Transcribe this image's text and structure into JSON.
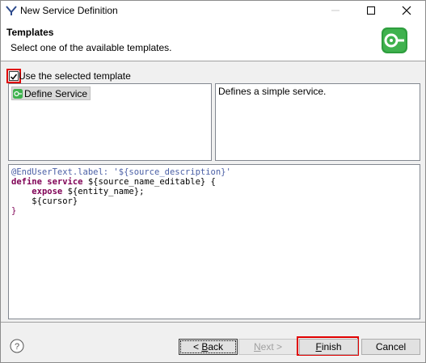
{
  "window": {
    "title": "New Service Definition"
  },
  "header": {
    "title": "Templates",
    "description": "Select one of the available templates."
  },
  "options": {
    "use_template_label": "Use the selected template",
    "use_template_checked": true
  },
  "templates": {
    "items": [
      {
        "label": "Define Service",
        "selected": true
      }
    ],
    "description": "Defines a simple service."
  },
  "code_preview": {
    "lines": [
      "@EndUserText.label: '${source_description}'",
      "define service ${source_name_editable} {",
      "    expose ${entity_name};",
      "    ${cursor}",
      "}"
    ]
  },
  "buttons": {
    "back_prefix": "< ",
    "back_mnemonic": "B",
    "back_rest": "ack",
    "next_mnemonic": "N",
    "next_rest": "ext >",
    "finish_mnemonic": "F",
    "finish_rest": "inish",
    "cancel": "Cancel"
  },
  "colors": {
    "highlight_red": "#e00000",
    "icon_green": "#2e9e3e",
    "annotation_blue": "#4a5fa5",
    "keyword_purple": "#7f0055"
  }
}
